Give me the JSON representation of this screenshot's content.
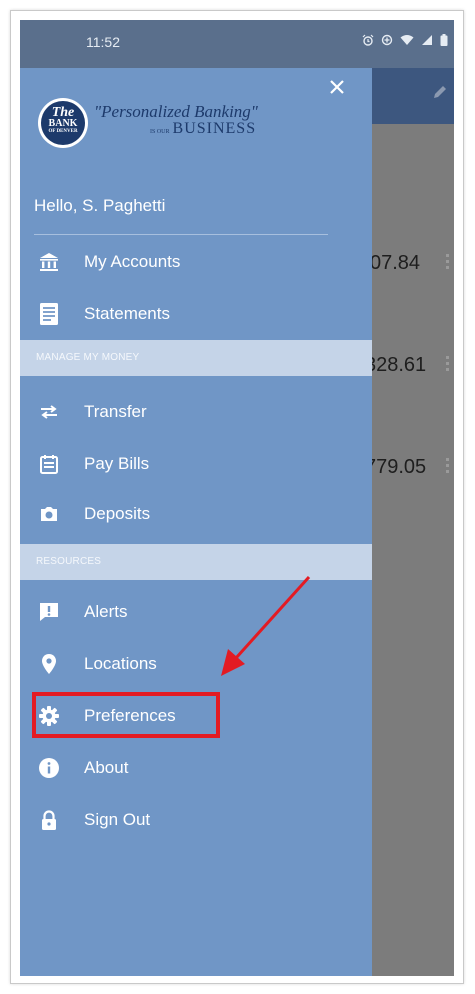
{
  "status_bar": {
    "time": "11:52"
  },
  "balances": [
    "07.84",
    "328.61",
    "779.05"
  ],
  "drawer": {
    "brand": {
      "seal_line1": "The",
      "seal_line2": "BANK",
      "seal_line3": "OF DENVER",
      "tagline_line1": "\"Personalized Banking\"",
      "tagline_small": "IS OUR",
      "tagline_line2": "BUSINESS"
    },
    "greeting": "Hello, S. Paghetti",
    "items": {
      "my_accounts": "My Accounts",
      "statements": "Statements",
      "transfer": "Transfer",
      "pay_bills": "Pay Bills",
      "deposits": "Deposits",
      "alerts": "Alerts",
      "locations": "Locations",
      "preferences": "Preferences",
      "about": "About",
      "sign_out": "Sign Out"
    },
    "sections": {
      "manage": "MANAGE MY MONEY",
      "resources": "RESOURCES"
    }
  },
  "annotation": {
    "color": "#e31b23",
    "highlighted_item": "Preferences"
  },
  "colors": {
    "drawer": "#7096c6",
    "header": "#3d577f",
    "section": "#c5d4e8"
  }
}
